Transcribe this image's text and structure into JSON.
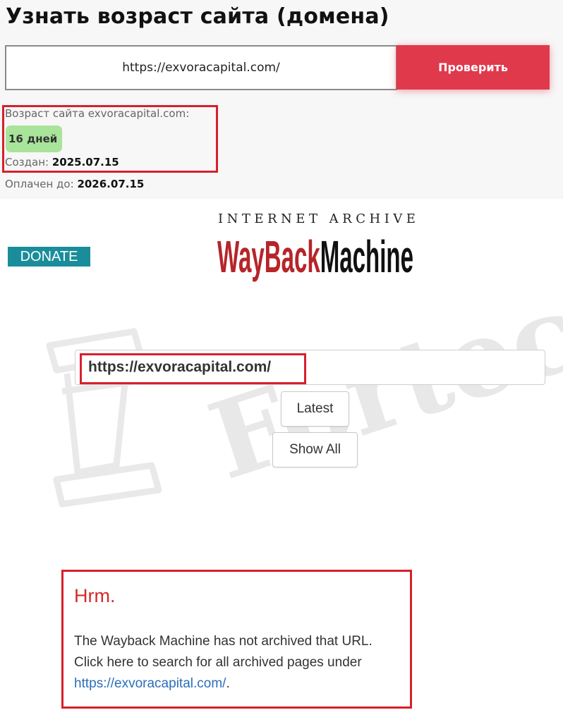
{
  "domain_age": {
    "title": "Узнать возраст сайта (домена)",
    "url_value": "https://exvoracapital.com/",
    "check_button": "Проверить",
    "age_label": "Возраст сайта exvoracapital.com:",
    "age_badge": "16 дней",
    "created_label": "Создан: ",
    "created_value": "2025.07.15",
    "paid_label": "Оплачен до: ",
    "paid_value": "2026.07.15"
  },
  "wayback": {
    "donate_label": "DONATE",
    "ia_text": "INTERNET ARCHIVE",
    "logo_word": "WayBackMachine",
    "search_value": "https://exvoracapital.com/",
    "latest_button": "Latest",
    "show_all_button": "Show All",
    "message": {
      "title": "Hrm.",
      "line1": "The Wayback Machine has not archived that URL.",
      "line2": "Click here to search for all archived pages under",
      "link": "https://exvoracapital.com/",
      "link_suffix": "."
    }
  },
  "watermark": "Forteck",
  "colors": {
    "accent_red": "#e0394c",
    "highlight_red": "#d7202b",
    "badge_green": "#a8e49a",
    "donate_teal": "#1a8d9b",
    "logo_red": "#b5252a",
    "link_blue": "#2a6ebb"
  },
  "icons": {
    "logo": "wayback-machine-logo",
    "watermark_icon": "podium-icon"
  }
}
